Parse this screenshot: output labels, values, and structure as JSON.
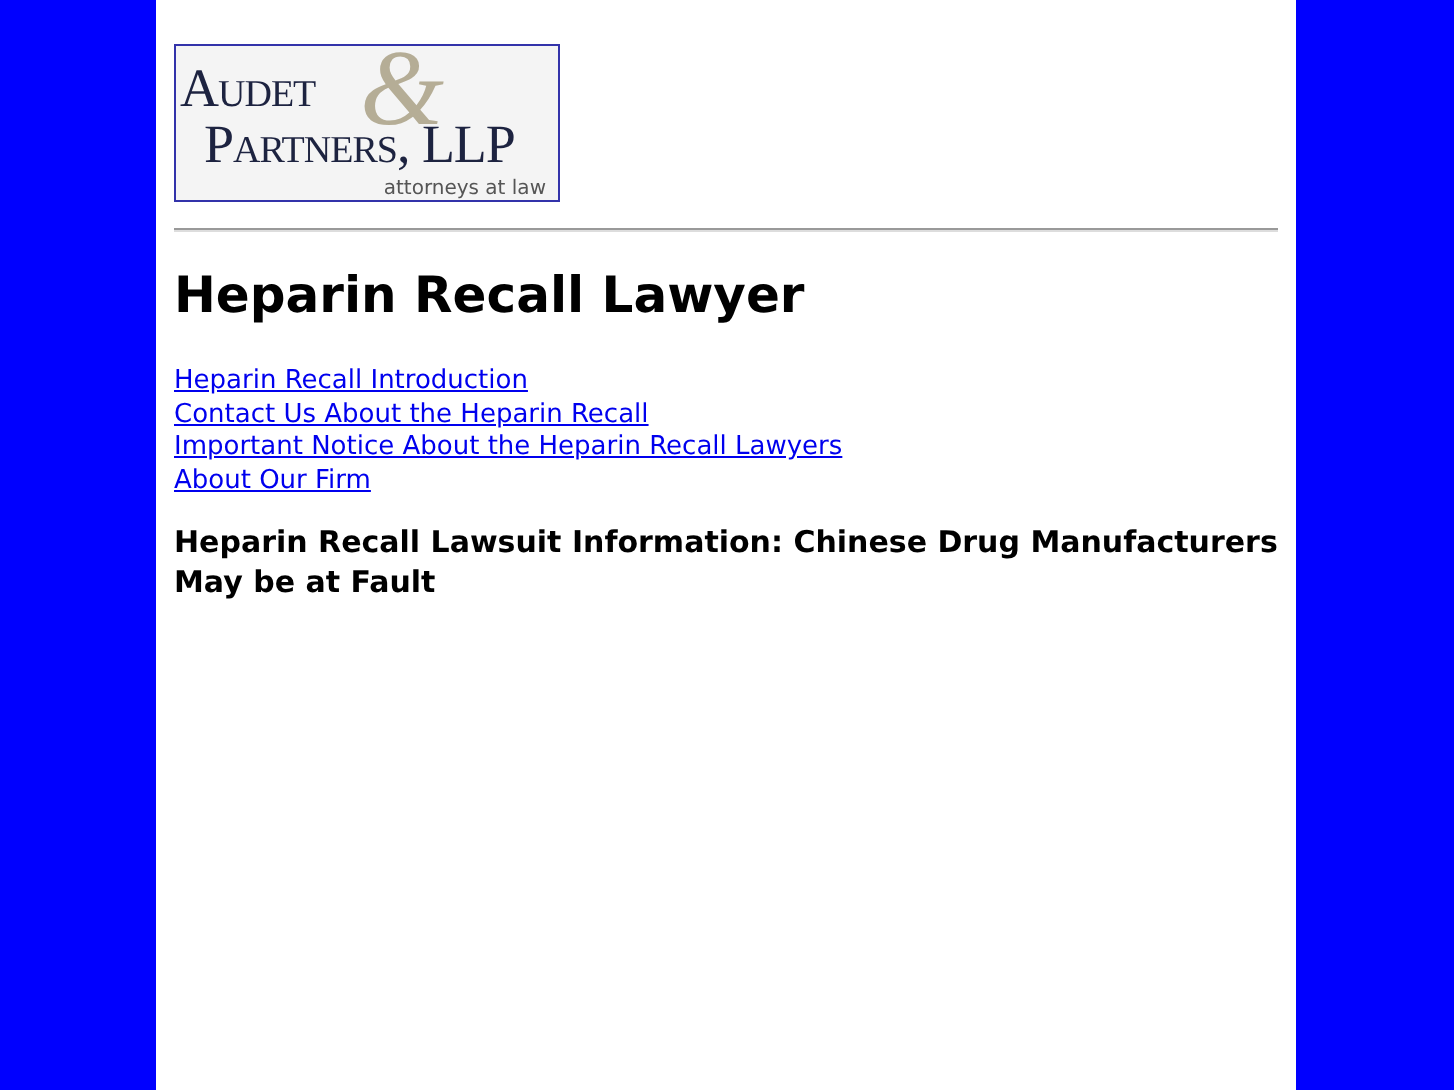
{
  "logo": {
    "line_1": "Audet",
    "ampersand": "&",
    "line_2": "Partners, LLP",
    "tagline": "attorneys at law"
  },
  "heading": "Heparin Recall Lawyer",
  "links": [
    "Heparin Recall Introduction",
    "Contact Us About the Heparin Recall",
    "Important Notice About the Heparin Recall Lawyers",
    "About Our Firm"
  ],
  "subheading": "Heparin Recall Lawsuit Information: Chinese Drug Manufacturers May be at Fault"
}
